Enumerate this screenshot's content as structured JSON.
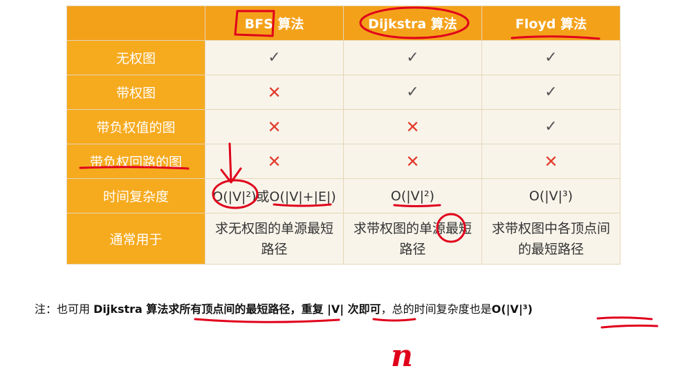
{
  "table": {
    "headers": [
      "",
      "BFS 算法",
      "Dijkstra 算法",
      "Floyd 算法"
    ],
    "rows": [
      {
        "label": "无权图",
        "cells": [
          "check",
          "check",
          "check"
        ]
      },
      {
        "label": "带权图",
        "cells": [
          "cross",
          "check",
          "check"
        ]
      },
      {
        "label": "带负权值的图",
        "cells": [
          "cross",
          "cross",
          "check"
        ]
      },
      {
        "label": "带负权回路的图",
        "cells": [
          "cross",
          "cross",
          "cross"
        ]
      }
    ],
    "complexity": {
      "label": "时间复杂度",
      "bfs": "O(|V|²)或O(|V|+|E|)",
      "dijkstra": "O(|V|²)",
      "floyd": "O(|V|³)"
    },
    "usage": {
      "label": "通常用于",
      "bfs": "求无权图的单源最短路径",
      "dijkstra": "求带权图的单源最短路径",
      "floyd": "求带权图中各顶点间的最短路径"
    }
  },
  "symbols": {
    "check": "✓",
    "cross": "✕"
  },
  "note": {
    "prefix": "注：也可用 ",
    "algo": "Dijkstra 算法",
    "part1": "求所有顶点间的最短路径，",
    "repeat": "重复 |V| 次即可",
    "part2": "，总的时间复杂度也是",
    "total": "O(|V|³)"
  },
  "handwriting": {
    "glyph": "n"
  },
  "colors": {
    "header": "#f4a11a",
    "row_header": "#f6aa1e",
    "body": "#f8f4ea",
    "ink": "#e0001b"
  }
}
